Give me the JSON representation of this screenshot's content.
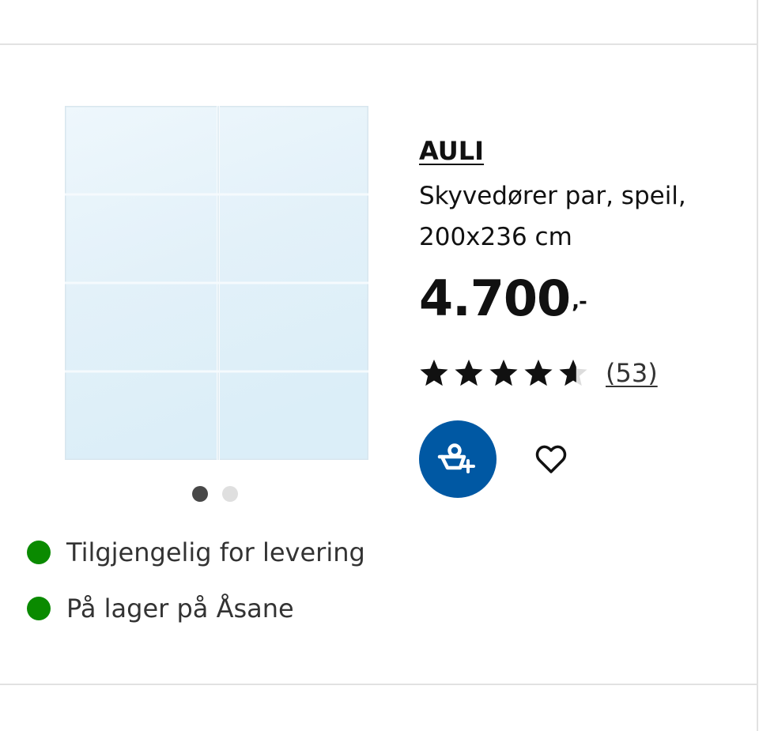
{
  "product": {
    "name": "AULI",
    "description": "Skyvedører par, speil, 200x236 cm",
    "price": "4.700",
    "price_suffix": ",-",
    "rating": 4.6,
    "rating_max": 5,
    "review_count": "(53)"
  },
  "carousel": {
    "total": 2,
    "active_index": 0
  },
  "availability": [
    {
      "label": "Tilgjengelig for levering",
      "status_color": "#0a8a00"
    },
    {
      "label": "På lager på Åsane",
      "status_color": "#0a8a00"
    }
  ],
  "actions": {
    "add_to_cart_icon": "basket-plus-icon",
    "favourite_icon": "heart-icon"
  },
  "colors": {
    "brand_blue": "#0058a3",
    "in_stock_green": "#0a8a00"
  }
}
